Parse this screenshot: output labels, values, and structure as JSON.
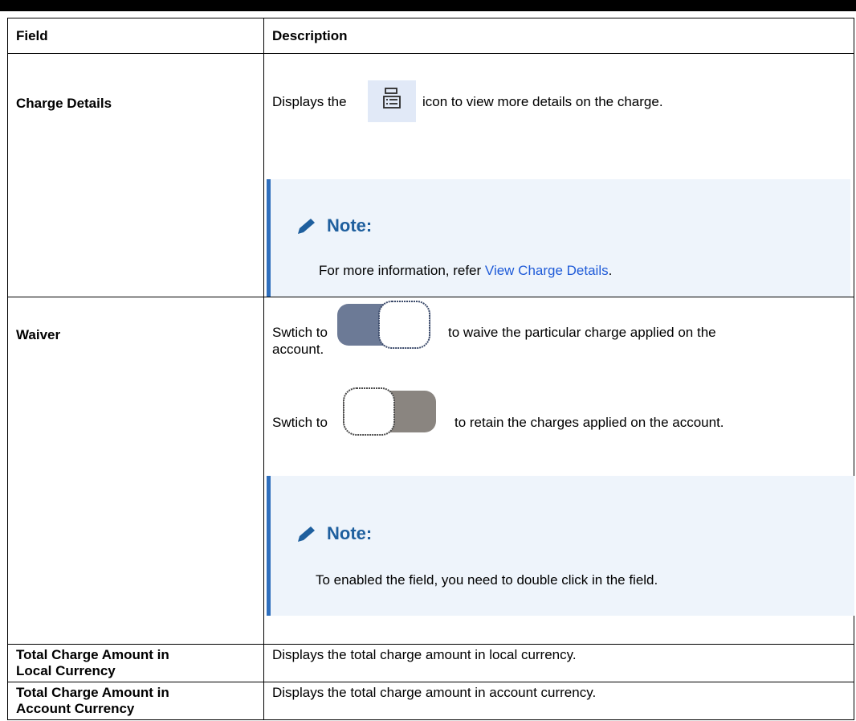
{
  "table": {
    "headers": [
      "Field",
      "Description"
    ],
    "charge_details": {
      "field": "Charge Details",
      "desc_before": "Displays the",
      "desc_after": "icon to view more details on the charge.",
      "note_title": "Note:",
      "note_prefix": "For more information, refer ",
      "note_link": "View Charge Details",
      "note_suffix": "."
    },
    "waiver": {
      "field": "Waiver",
      "line1_prefix": "Swtich to",
      "line1_suffix": "to waive the particular charge applied on the",
      "line1_cont": "account.",
      "line2_prefix": "Swtich to",
      "line2_suffix": "to retain the charges applied on the account.",
      "note_title": "Note:",
      "note_text": "To enabled the field, you need to double click in the field."
    },
    "local": {
      "field_line1": "Total Charge Amount in",
      "field_line2": "Local Currency",
      "desc": "Displays the total charge amount in local currency."
    },
    "account": {
      "field_line1": "Total Charge Amount in",
      "field_line2": "Account Currency",
      "desc": "Displays the total charge amount in account currency."
    }
  },
  "colors": {
    "toggle_on": "#6c7a96",
    "toggle_off": "#8a8580",
    "note_bg": "#eef4fb",
    "note_bar": "#2f6fbd",
    "link": "#1f5bd8"
  },
  "icons": [
    "details-icon",
    "pencil-icon",
    "toggle-on-icon",
    "toggle-off-icon"
  ]
}
